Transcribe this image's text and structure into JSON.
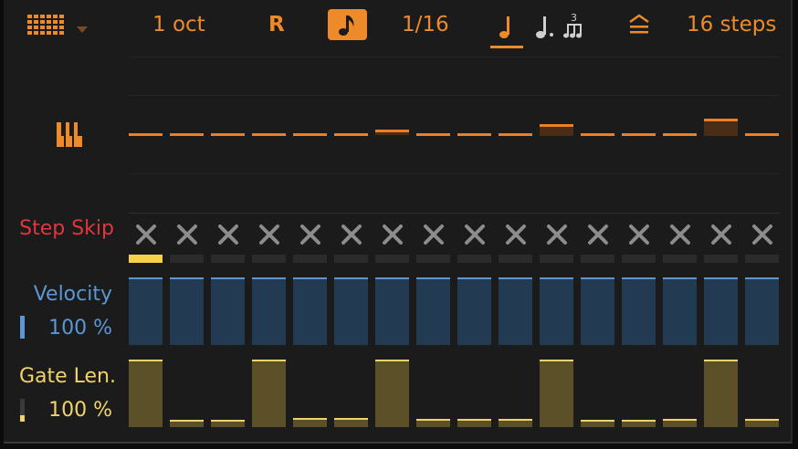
{
  "header": {
    "octave_label": "1 oct",
    "record_label": "R",
    "rate_label": "1/16",
    "steps_label": "16 steps"
  },
  "icons": {
    "grid_menu": "grid-icon",
    "dropdown": "chevron-down-icon",
    "note_toggle": "eighth-note-icon",
    "straight": "quarter-note-icon",
    "dotted": "dotted-note-icon",
    "triplet": "triplet-icon",
    "shuffle": "stack-icon",
    "piano": "piano-keys-icon",
    "skip": "close-icon"
  },
  "colors": {
    "accent": "#ef8a2a",
    "step_skip": "#e0363c",
    "velocity": "#5a97d4",
    "gate": "#f2d36a"
  },
  "lanes": {
    "step_skip": {
      "label": "Step Skip"
    },
    "velocity": {
      "label": "Velocity",
      "value": "100 %"
    },
    "gate": {
      "label": "Gate Len.",
      "value": "100 %"
    }
  },
  "steps": {
    "count": 16,
    "pitch_raised": [
      0,
      0,
      0,
      0,
      0,
      0,
      1,
      0,
      0,
      0,
      2,
      0,
      0,
      0,
      3,
      0
    ],
    "skip_active": [
      true,
      false,
      false,
      false,
      false,
      false,
      false,
      false,
      false,
      false,
      false,
      false,
      false,
      false,
      false,
      false
    ],
    "velocity": [
      1,
      1,
      1,
      1,
      1,
      1,
      1,
      1,
      1,
      1,
      1,
      1,
      1,
      1,
      1,
      1
    ],
    "gate": [
      1,
      0.1,
      0.1,
      1,
      0.13,
      0.13,
      1,
      0.12,
      0.12,
      0.12,
      1,
      0.1,
      0.1,
      0.12,
      1,
      0.12
    ]
  }
}
